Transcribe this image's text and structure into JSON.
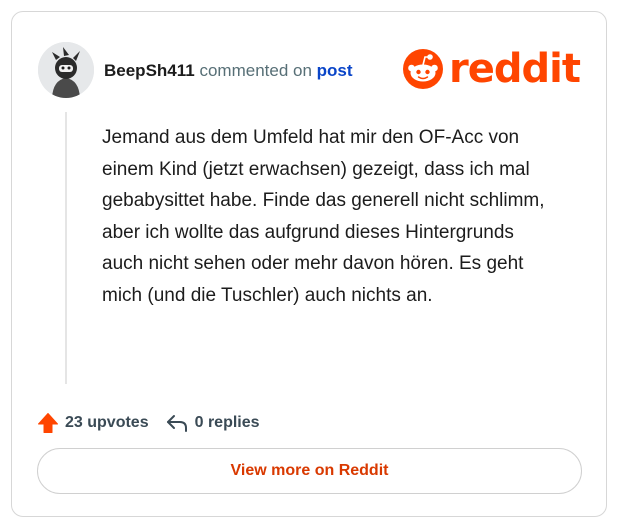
{
  "comment": {
    "author": "BeepSh411",
    "action_text": "commented on",
    "post_link": "post",
    "body": "Jemand aus dem Umfeld hat mir den OF-Acc von einem Kind (jetzt erwachsen) gezeigt, dass ich mal gebabysittet habe. Finde das generell nicht schlimm, aber ich wollte das aufgrund dieses Hintergrunds auch nicht sehen oder mehr davon hören. Es geht mich (und die Tuschler) auch nichts an.",
    "upvotes_label": "23 upvotes",
    "replies_label": "0 replies"
  },
  "brand": {
    "wordmark": "reddit",
    "color": "#ff4500"
  },
  "cta": {
    "label": "View more on Reddit"
  },
  "icons": {
    "avatar": "user-avatar",
    "logo": "reddit-snoo-icon",
    "upvote": "upvote-arrow-icon",
    "reply": "reply-arrow-icon"
  }
}
